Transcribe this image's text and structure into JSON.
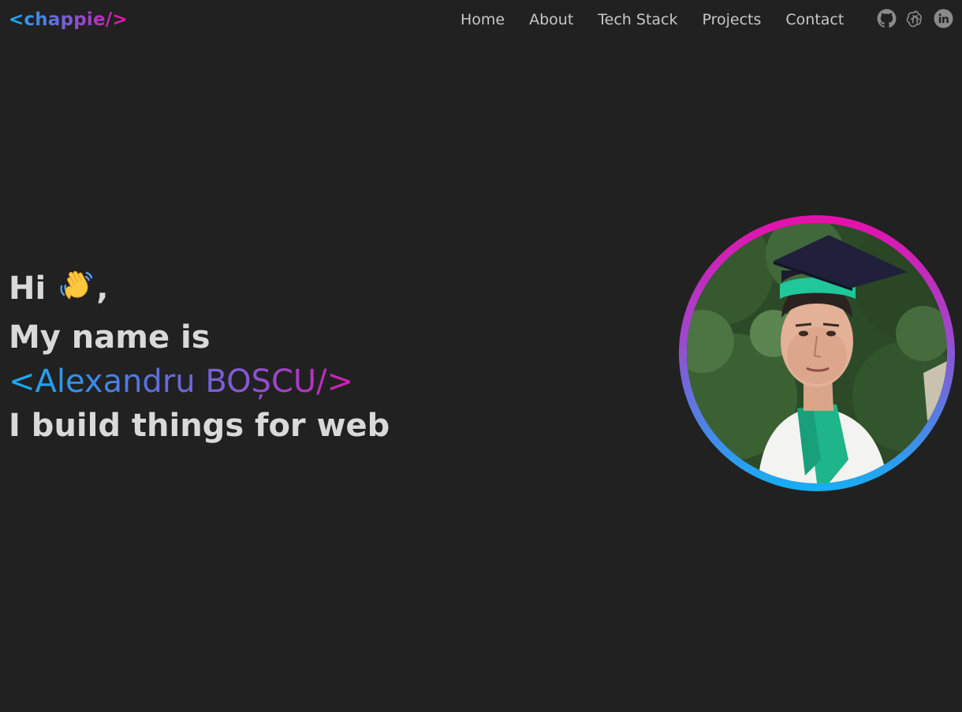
{
  "header": {
    "logo": "<chappie/>",
    "nav": [
      {
        "label": "Home"
      },
      {
        "label": "About"
      },
      {
        "label": "Tech Stack"
      },
      {
        "label": "Projects"
      },
      {
        "label": "Contact"
      }
    ],
    "socials": [
      {
        "icon": "github-icon"
      },
      {
        "icon": "openai-icon"
      },
      {
        "icon": "linkedin-icon"
      }
    ]
  },
  "hero": {
    "greeting": "Hi",
    "wave_emoji": "👋",
    "greeting_suffix": ",",
    "intro": "My name is",
    "name": "<Alexandru BOȘCU/>",
    "tagline": "I build things for web"
  },
  "colors": {
    "background": "#212121",
    "text": "#d9d9d9",
    "nav_text": "#c8c8c8",
    "gradient_start": "#13b0f5",
    "gradient_end": "#e70faa"
  }
}
